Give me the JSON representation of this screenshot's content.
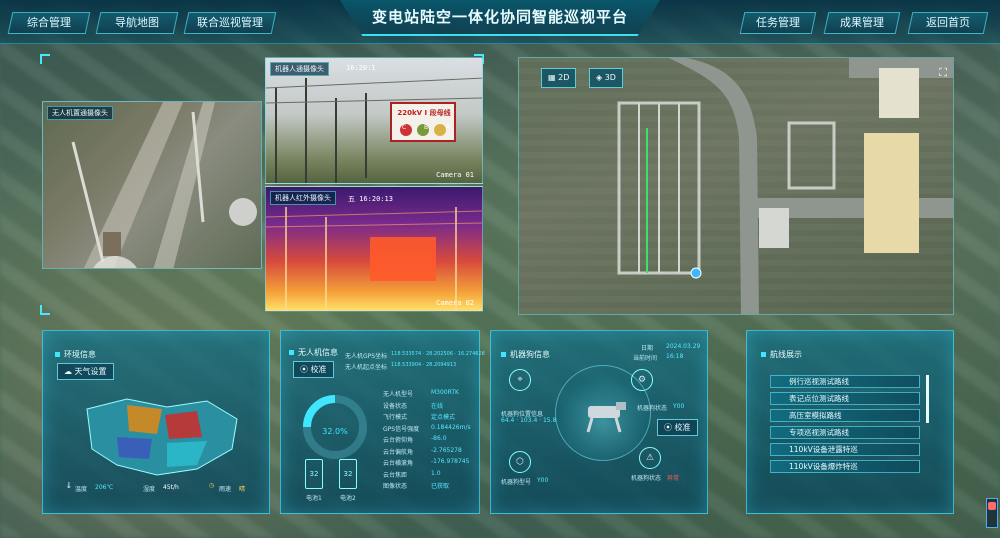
{
  "header": {
    "title": "变电站陆空一体化协同智能巡视平台",
    "nav_left": [
      "综合管理",
      "导航地图",
      "联合巡视管理"
    ],
    "nav_right": [
      "任务管理",
      "成果管理",
      "返回首页"
    ]
  },
  "cameras": {
    "uav": {
      "label": "无人机置通摄像头"
    },
    "robot_visible": {
      "label": "机器人通摄像头",
      "timestamp": "16:20:1",
      "camera_id": "Camera 01",
      "sign_text": "220kV I 段母线",
      "sign_phases": [
        "C",
        "B",
        "A"
      ]
    },
    "robot_infrared": {
      "label": "机器人红外摄像头",
      "timestamp": "五 16:20:13",
      "camera_id": "Camera 02"
    }
  },
  "map": {
    "btn_2d": "2D",
    "btn_3d": "3D"
  },
  "environment": {
    "title": "环境信息",
    "weather_btn": "天气设置",
    "temp_label": "温度",
    "temp_value": "206℃",
    "humidity_label": "湿度",
    "wind_value": "45t/h",
    "rain_label": "雨速",
    "rain_value": "晴"
  },
  "uav": {
    "title": "无人机信息",
    "calibrate_btn": "校准",
    "gps_lines": [
      {
        "label": "无人机GPS坐标",
        "value": "118.533574 · 28.202506 · 16.274628"
      },
      {
        "label": "无人机起点坐标",
        "value": "118.533904 · 28.2094913"
      }
    ],
    "percent": "32.0%",
    "battery_left": "32",
    "battery_right": "32",
    "battery_left_label": "电池1",
    "battery_right_label": "电池2",
    "fields": [
      {
        "label": "无人机型号",
        "value": "M300RTK"
      },
      {
        "label": "设备状态",
        "value": "在线"
      },
      {
        "label": "飞行模式",
        "value": "定点模式"
      },
      {
        "label": "GPS信号强度",
        "value": "0.184426m/s"
      },
      {
        "label": "云台俯仰角",
        "value": "-86.0"
      },
      {
        "label": "云台偏航角",
        "value": "-2.765278"
      },
      {
        "label": "云台横滚角",
        "value": "-176.978745"
      },
      {
        "label": "云台焦距",
        "value": "1.0"
      },
      {
        "label": "图像状态",
        "value": "已获取"
      }
    ]
  },
  "robot": {
    "title": "机器狗信息",
    "date_label": "日期",
    "date_value": "2024.03.29",
    "time_label": "当前时间",
    "time_value": "16:18",
    "calibrate_btn": "校准",
    "left_label": "机器狗位置信息",
    "left_value": "64.4 · 103.4 · 15.8",
    "right_label": "机器狗状态",
    "right_value": "Y00",
    "model_label": "机器狗型号",
    "model_value": "Y00",
    "status_label": "机器狗状态",
    "status_value": "异常"
  },
  "routes": {
    "title": "航线展示",
    "items": [
      "例行巡视测试路线",
      "表记点位测试路线",
      "高压室模拟路线",
      "专项巡视测试路线",
      "110kV设备泄露特巡",
      "110kV设备爆炸特巡"
    ]
  },
  "colors": {
    "accent": "#3fe6ff",
    "panel": "#0e6a80",
    "warn": "#ff5a5a"
  }
}
